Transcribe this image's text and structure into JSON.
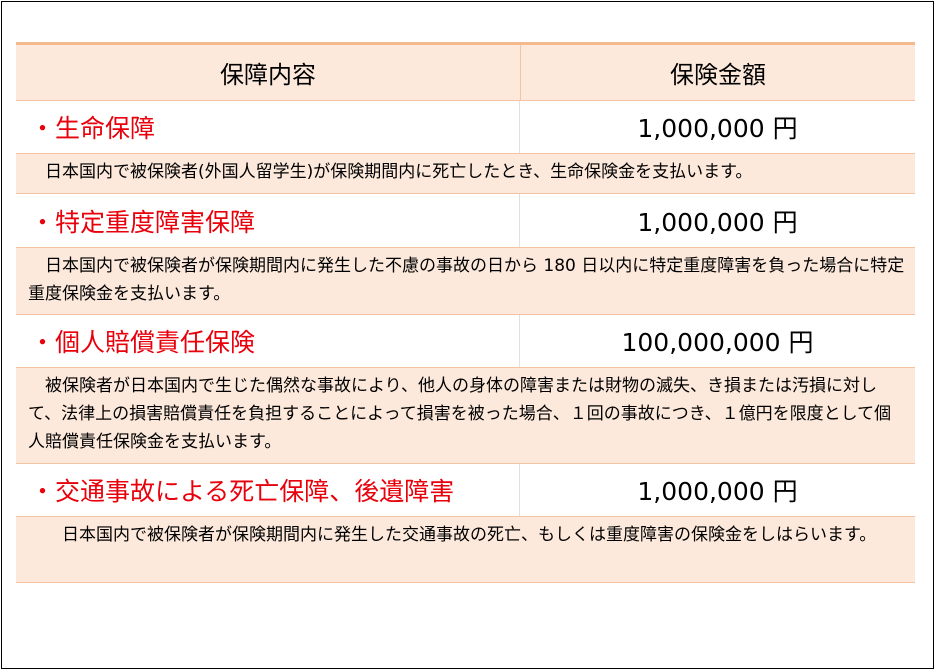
{
  "table": {
    "header": {
      "col1": "保障内容",
      "col2": "保険金額"
    },
    "rows": [
      {
        "name": "・生命保障",
        "amount": "1,000,000 円",
        "desc": "　日本国内で被保険者(外国人留学生)が保険期間内に死亡したとき、生命保険金を支払います。"
      },
      {
        "name": "・特定重度障害保障",
        "amount": "1,000,000 円",
        "desc": "　日本国内で被保険者が保険期間内に発生した不慮の事故の日から 180 日以内に特定重度障害を負った場合に特定重度保険金を支払います。"
      },
      {
        "name": "・個人賠償責任保険",
        "amount": "100,000,000 円",
        "desc": "　被保険者が日本国内で生じた偶然な事故により、他人の身体の障害または財物の滅失、き損または汚損に対して、法律上の損害賠償責任を負担することによって損害を被った場合、１回の事故につき、１億円を限度として個人賠償責任保険金を支払います。"
      },
      {
        "name": "・交通事故による死亡保障、後遺障害",
        "amount": "1,000,000 円",
        "desc": "　　日本国内で被保険者が保険期間内に発生した交通事故の死亡、もしくは重度障害の保険金をしはらいます。"
      }
    ]
  }
}
